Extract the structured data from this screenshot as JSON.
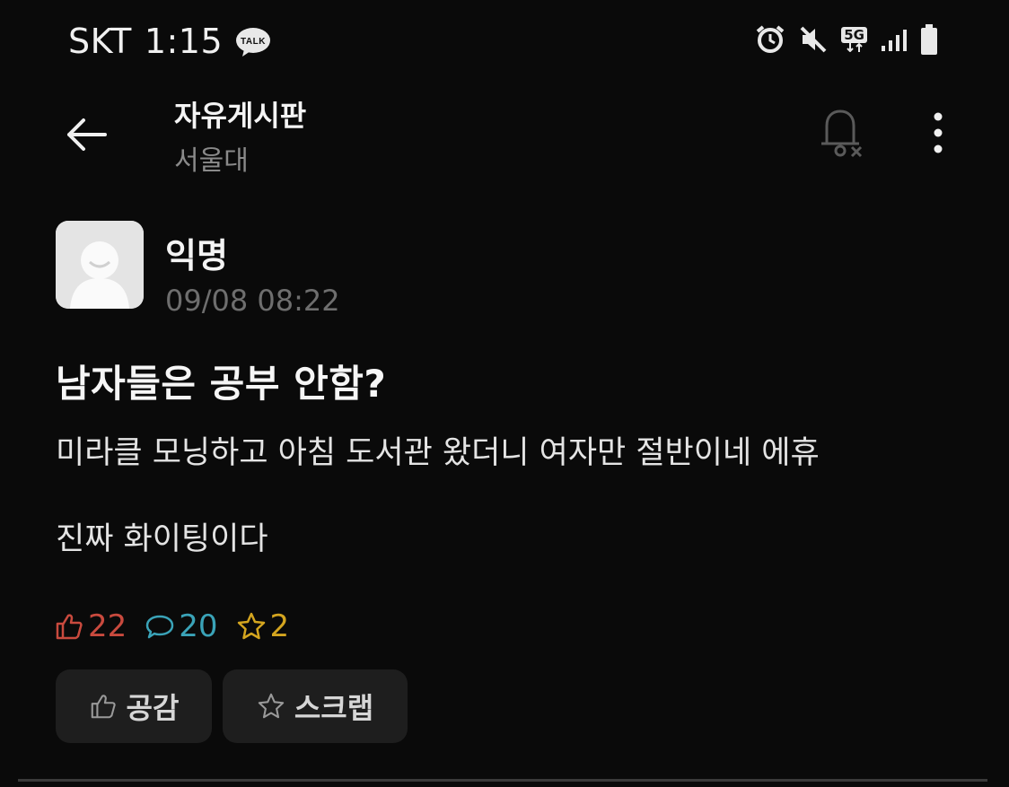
{
  "status_bar": {
    "carrier": "SKT",
    "time": "1:15",
    "talk_badge": "TALK",
    "network": "5G",
    "icons": [
      "kakaotalk-icon",
      "alarm-icon",
      "mute-icon",
      "5g-icon",
      "signal-icon",
      "battery-icon"
    ]
  },
  "header": {
    "title": "자유게시판",
    "subtitle": "서울대",
    "icons": [
      "back-arrow-icon",
      "bell-off-icon",
      "more-vertical-icon"
    ]
  },
  "post": {
    "author": "익명",
    "timestamp": "09/08 08:22",
    "title": "남자들은 공부 안함?",
    "body": [
      "미라클 모닝하고 아침 도서관 왔더니 여자만 절반이네 에휴",
      "진짜 화이팅이다"
    ],
    "counts": {
      "likes": "22",
      "comments": "20",
      "scraps": "2"
    }
  },
  "actions": {
    "like_label": "공감",
    "scrap_label": "스크랩"
  },
  "colors": {
    "background": "#0a0a0a",
    "like": "#c94a3e",
    "comment": "#3aa3b8",
    "scrap": "#d4a51f",
    "button_bg": "#1e1e1e"
  }
}
